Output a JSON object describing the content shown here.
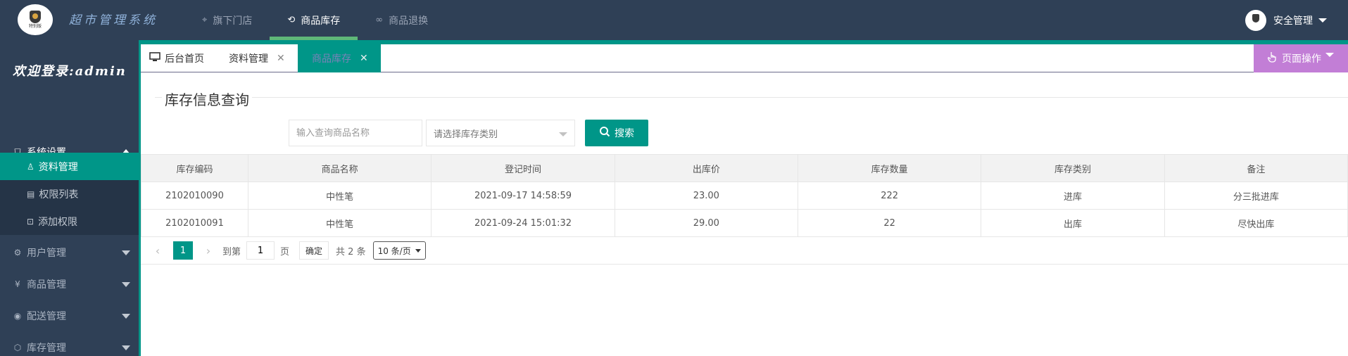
{
  "app": {
    "title": "超市管理系统",
    "logo_text": "特别版"
  },
  "topnav": {
    "items": [
      {
        "icon": "location-pin-icon",
        "glyph": "⌖",
        "label": "旗下门店"
      },
      {
        "icon": "inventory-icon",
        "glyph": "⟲",
        "label": "商品库存"
      },
      {
        "icon": "return-icon",
        "glyph": "∞",
        "label": "商品退换"
      }
    ],
    "active_index": 1
  },
  "user": {
    "label": "安全管理"
  },
  "sidebar": {
    "welcome": "欢迎登录:admin",
    "groups": [
      {
        "icon": "shield-icon",
        "glyph": "⛉",
        "label": "系统设置",
        "expanded": true
      },
      {
        "icon": "gear-icon",
        "glyph": "⚙",
        "label": "用户管理",
        "expanded": false
      },
      {
        "icon": "yen-icon",
        "glyph": "¥",
        "label": "商品管理",
        "expanded": false
      },
      {
        "icon": "delivery-icon",
        "glyph": "◉",
        "label": "配送管理",
        "expanded": false
      },
      {
        "icon": "box-icon",
        "glyph": "⬡",
        "label": "库存管理",
        "expanded": false
      }
    ],
    "sub_items": [
      {
        "icon": "user-icon",
        "glyph": "♙",
        "label": "资料管理",
        "active": true
      },
      {
        "icon": "list-icon",
        "glyph": "▤",
        "label": "权限列表",
        "active": false
      },
      {
        "icon": "lock-icon",
        "glyph": "⊡",
        "label": "添加权限",
        "active": false
      }
    ]
  },
  "tabs": {
    "items": [
      {
        "icon": "monitor-icon",
        "label": "后台首页",
        "closable": false
      },
      {
        "label": "资料管理",
        "closable": true
      },
      {
        "label": "商品库存",
        "closable": true
      }
    ],
    "active_index": 2,
    "close_glyph": "✕",
    "page_ops_label": "页面操作"
  },
  "section": {
    "title": "库存信息查询"
  },
  "search": {
    "placeholder": "输入查询商品名称",
    "value": "",
    "category_placeholder": "请选择库存类别",
    "button_label": "搜索"
  },
  "table": {
    "headers": [
      "库存编码",
      "商品名称",
      "登记时间",
      "出库价",
      "库存数量",
      "库存类别",
      "备注"
    ],
    "rows": [
      [
        "2102010090",
        "中性笔",
        "2021-09-17 14:58:59",
        "23.00",
        "222",
        "进库",
        "分三批进库"
      ],
      [
        "2102010091",
        "中性笔",
        "2021-09-24 15:01:32",
        "29.00",
        "22",
        "出库",
        "尽快出库"
      ]
    ]
  },
  "pager": {
    "current_page": "1",
    "goto_label": "到第",
    "goto_value": "1",
    "page_unit": "页",
    "confirm_label": "确定",
    "total_label": "共 2 条",
    "page_size_label": "10 条/页"
  },
  "colors": {
    "header_bg": "#2f4056",
    "accent": "#009688",
    "in_stock": "#2a2ee0",
    "out_stock": "#ff5722",
    "page_ops_bg": "#c27ed6"
  }
}
